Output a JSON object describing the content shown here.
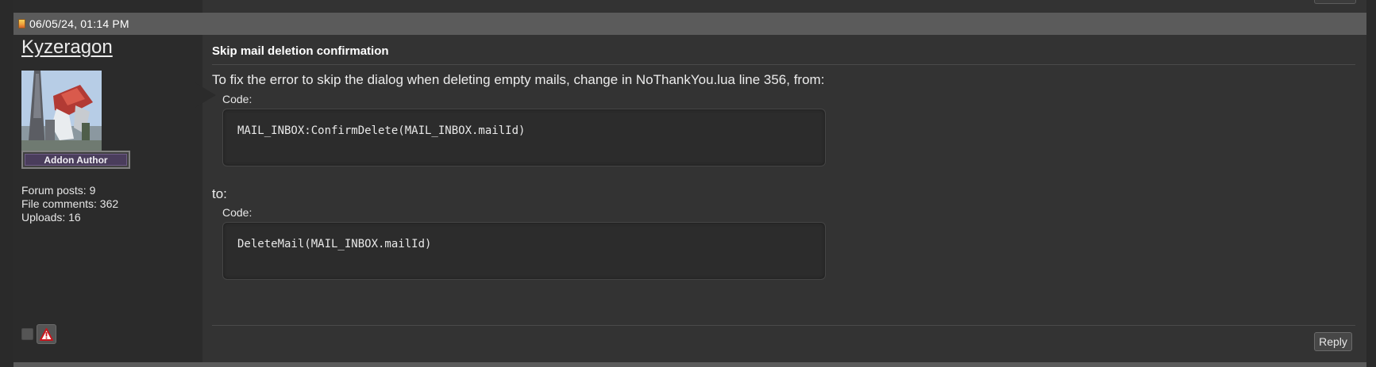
{
  "post": {
    "date": "06/05/24, 01:14 PM",
    "subject": "Skip mail deletion confirmation",
    "intro": "To fix the error to skip the dialog when deleting empty mails, change in NoThankYou.lua line 356, from:",
    "code_label_1": "Code:",
    "code_1": "MAIL_INBOX:ConfirmDelete(MAIL_INBOX.mailId)",
    "middle": "to:",
    "code_label_2": "Code:",
    "code_2": "DeleteMail(MAIL_INBOX.mailId)",
    "reply_label": "Reply"
  },
  "author": {
    "name": "Kyzeragon",
    "rank": "Addon Author",
    "stats": {
      "forum_posts": "Forum posts: 9",
      "file_comments": "File comments: 362",
      "uploads": "Uploads: 16"
    }
  },
  "icons": {
    "post_icon": "post-status-icon",
    "report_icon": "warning-icon"
  }
}
